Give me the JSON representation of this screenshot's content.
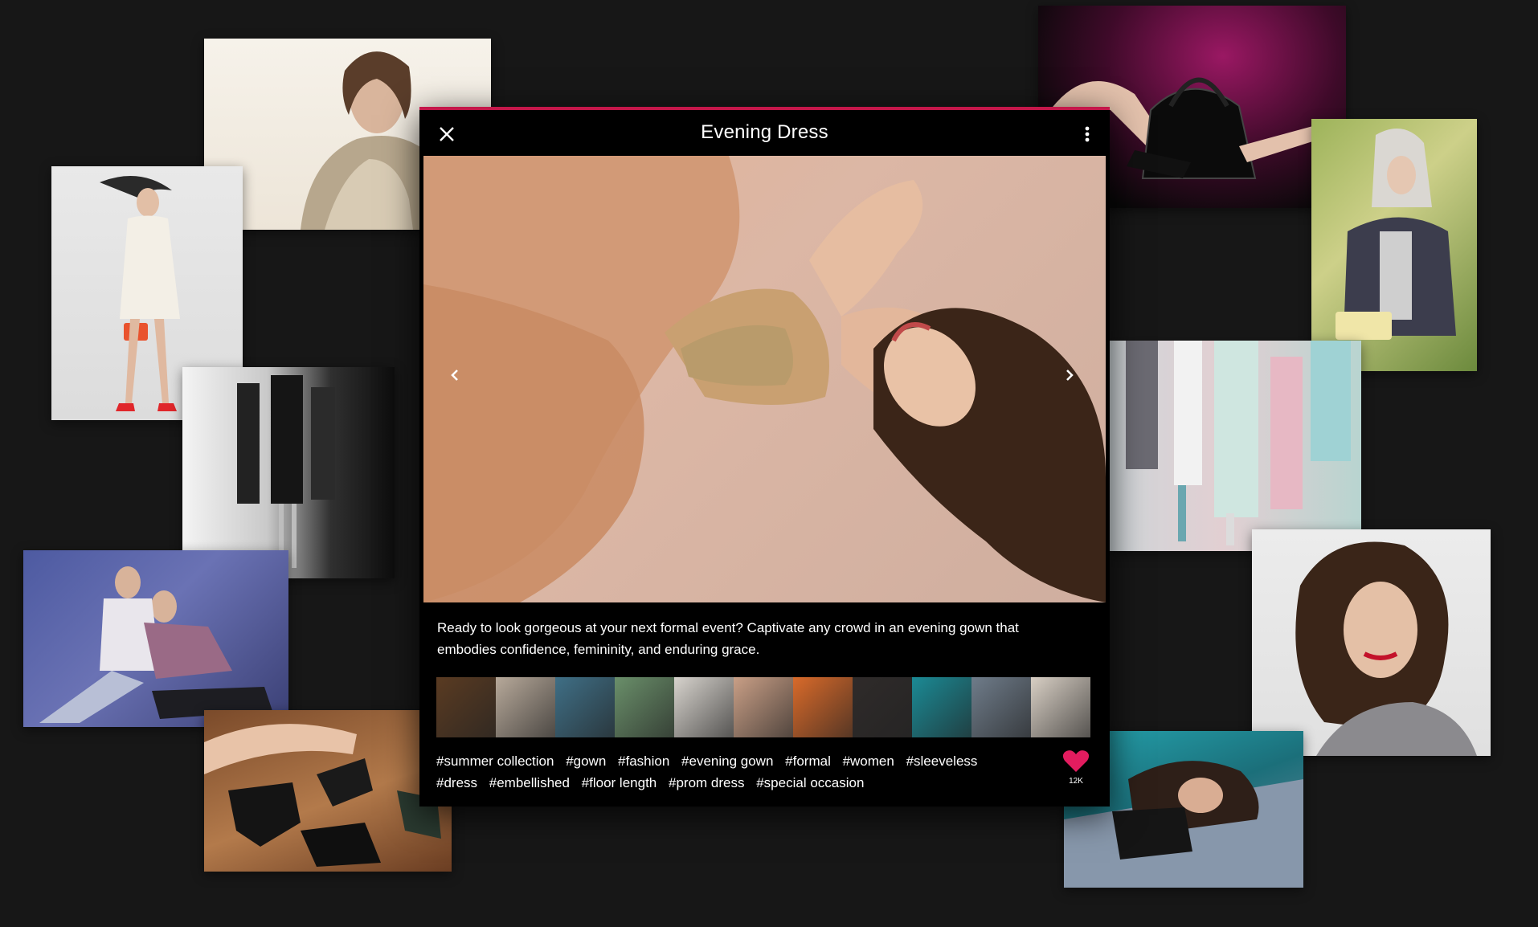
{
  "modal": {
    "title": "Evening Dress",
    "description": "Ready to look gorgeous at your next formal event? Captivate any crowd in an evening gown that embodies confidence, femininity, and enduring grace.",
    "hashtags": [
      "#summer collection",
      "#gown",
      "#fashion",
      "#evening gown",
      "#formal",
      "#women",
      "#sleeveless",
      "#dress",
      "#embellished",
      "#floor length",
      "#prom dress",
      "#special occasion"
    ],
    "likes": "12K",
    "accent_color": "#c4174a",
    "thumbnail_colors": [
      "#5a3b22",
      "#b7a99a",
      "#3f6f86",
      "#6a8f6a",
      "#d7d3cd",
      "#c99f86",
      "#d96a2a",
      "#2f2b2a",
      "#1b8a95",
      "#6f7c8a",
      "#d8cfc4"
    ]
  },
  "icons": {
    "close": "close-icon",
    "more": "more-vertical-icon",
    "prev": "chevron-left-icon",
    "next": "chevron-right-icon",
    "like": "heart-icon"
  }
}
